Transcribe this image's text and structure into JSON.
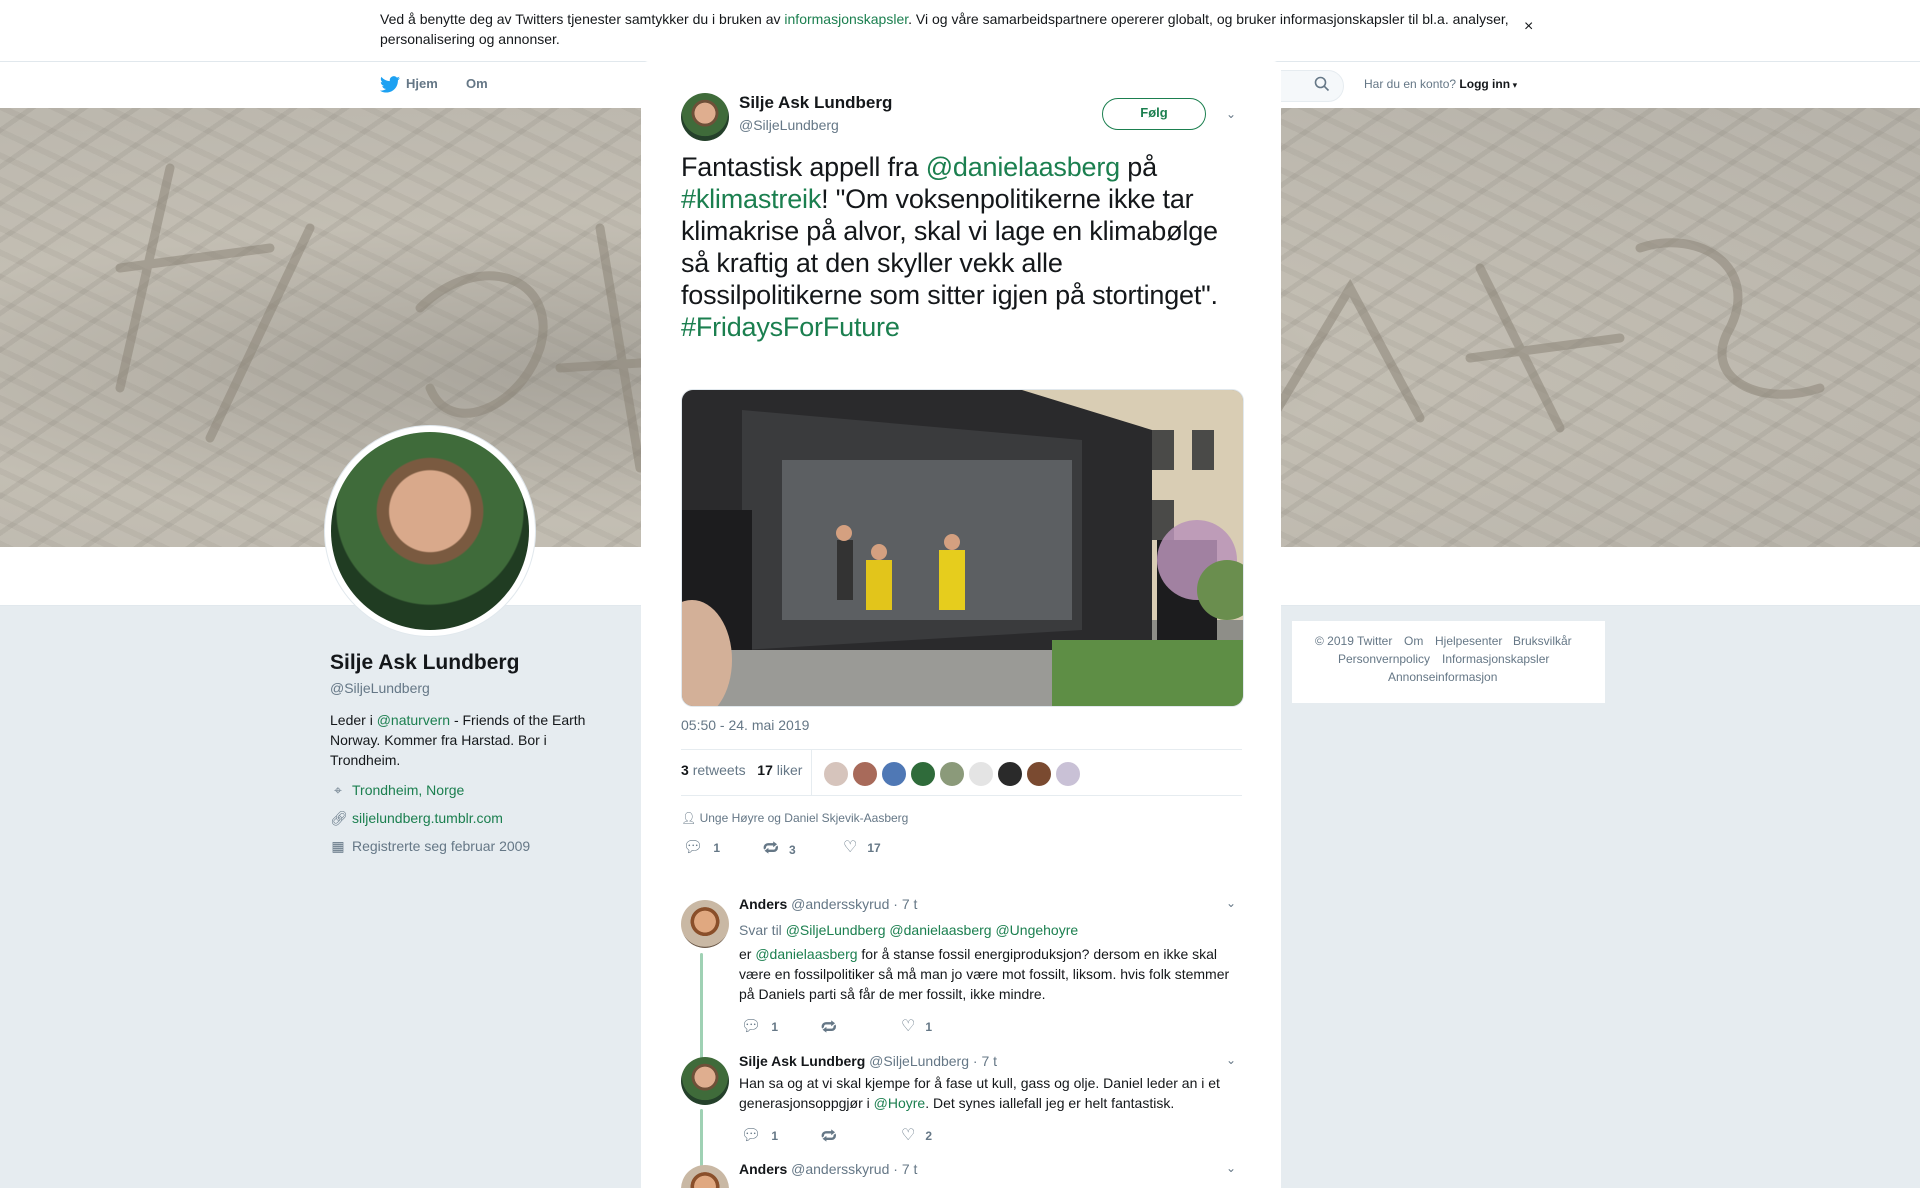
{
  "cookie": {
    "text_before": "Ved å benytte deg av Twitters tjenester samtykker du i bruken av ",
    "link": "informasjonskapsler",
    "text_after": ". Vi og våre samarbeidspartnere opererer globalt, og bruker informasjonskapsler til bl.a. analyser, personalisering og annonser.",
    "close": "×"
  },
  "page_close": "×",
  "nav": {
    "home": "Hjem",
    "about": "Om",
    "login_prompt": "Har du en konto?",
    "login": "Logg inn"
  },
  "profile": {
    "name": "Silje Ask Lundberg",
    "handle": "@SiljeLundberg",
    "bio_before": "Leder i ",
    "bio_link": "@naturvern",
    "bio_after": " - Friends of the Earth Norway. Kommer fra Harstad. Bor i Trondheim.",
    "location": "Trondheim, Norge",
    "website": "siljelundberg.tumblr.com",
    "joined": "Registrerte seg februar 2009"
  },
  "footer": {
    "copyright": "© 2019 Twitter",
    "about": "Om",
    "help": "Hjelpesenter",
    "terms": "Bruksvilkår",
    "privacy": "Personvernpolicy",
    "cookies": "Informasjonskapsler",
    "ads": "Annonseinformasjon"
  },
  "tweet": {
    "author_name": "Silje Ask Lundberg",
    "author_handle": "@SiljeLundberg",
    "follow": "Følg",
    "text": {
      "p1": "Fantastisk appell fra ",
      "mention": "@danielaasberg",
      "p2": " på ",
      "hashtag1": "#klimastreik",
      "p3": "! \"Om voksenpolitikerne ikke tar klimakrise på alvor, skal vi lage en klimabølge så kraftig at den skyller vekk alle fossilpolitikerne som sitter igjen på stortinget\".",
      "hashtag2": "#FridaysForFuture"
    },
    "date": "05:50 - 24. mai 2019",
    "retweets_count": "3",
    "retweets_label": "retweets",
    "likes_count": "17",
    "likes_label": "liker",
    "liked_by": "Unge Høyre og Daniel Skjevik-Aasberg",
    "actions": {
      "replies": "1",
      "retweets": "3",
      "likes": "17"
    }
  },
  "replies": [
    {
      "name": "Anders",
      "handle": "@andersskyrud",
      "time": "· 7 t",
      "reply_to_label": "Svar til",
      "reply_to": "@SiljeLundberg @danielaasberg @Ungehoyre",
      "body_before": "er ",
      "body_mention": "@danielaasberg",
      "body_after": " for å stanse fossil energiproduksjon? dersom en ikke skal være en fossilpolitiker så må man jo være mot fossilt, liksom. hvis folk stemmer på Daniels parti så får de mer fossilt, ikke mindre.",
      "replies": "1",
      "likes": "1"
    },
    {
      "name": "Silje Ask Lundberg",
      "handle": "@SiljeLundberg",
      "time": "· 7 t",
      "body_before": "Han sa og at vi skal kjempe for å fase ut kull, gass og olje. Daniel leder an i et generasjonsoppgjør i ",
      "body_mention": "@Hoyre",
      "body_after": ". Det synes iallefall jeg er helt fantastisk.",
      "replies": "1",
      "likes": "2"
    },
    {
      "name": "Anders",
      "handle": "@andersskyrud",
      "time": "· 7 t"
    }
  ],
  "colors": {
    "accent": "#1b7f4f",
    "muted": "#657786",
    "thread": "#9fd1b4"
  }
}
